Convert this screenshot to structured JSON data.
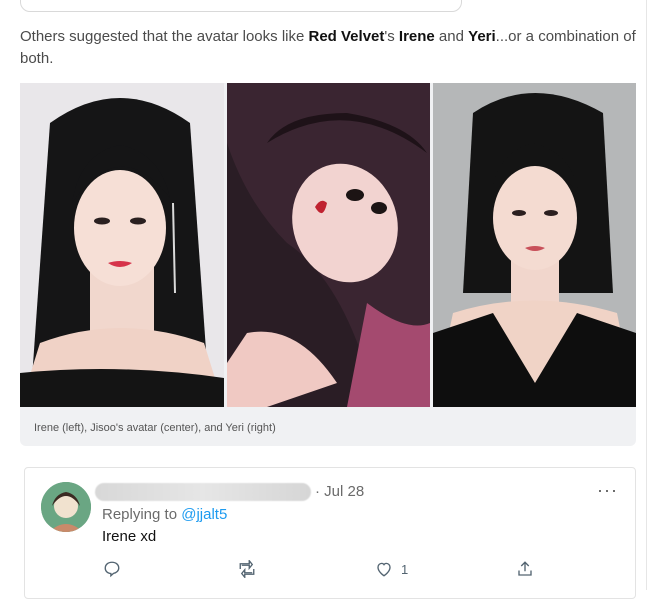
{
  "article": {
    "intro_1": "Others suggested that the avatar looks like ",
    "red_velvet": "Red Velvet",
    "intro_2": "'s ",
    "irene": "Irene",
    "intro_3": " and ",
    "yeri": "Yeri",
    "intro_4": "...or a combination of both."
  },
  "figure": {
    "caption": "Irene (left), Jisoo's avatar (center), and Yeri (right)"
  },
  "tweet": {
    "date": "· Jul 28",
    "more": "···",
    "replying_prefix": "Replying to ",
    "replying_handle": "@jjalt5",
    "text": "Irene xd",
    "like_count": "1"
  },
  "colors": {
    "link": "#1d9bf0",
    "text": "#111111",
    "muted": "#6b6b6b"
  }
}
